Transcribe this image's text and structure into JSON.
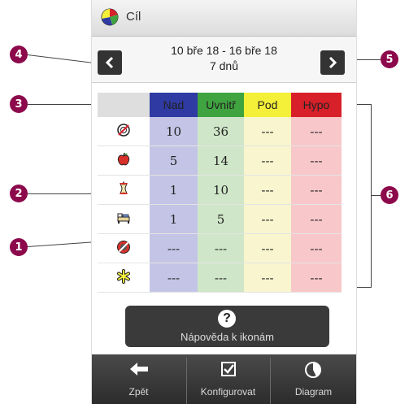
{
  "header": {
    "title": "Cíl",
    "app_icon": "pie-chart-icon"
  },
  "date_range": {
    "dates": "10 bře 18 - 16 bře 18",
    "span": "7 dnů"
  },
  "table": {
    "columns": [
      "Nad",
      "Uvnitř",
      "Pod",
      "Hypo"
    ],
    "column_colors": [
      "#2f3aa3",
      "#3fa43f",
      "#f4ef38",
      "#d8202a"
    ],
    "rows": [
      {
        "icon": "no-meal-mark-icon",
        "values": [
          "10",
          "36",
          "---",
          "---"
        ]
      },
      {
        "icon": "before-meal-apple-icon",
        "values": [
          "5",
          "14",
          "---",
          "---"
        ]
      },
      {
        "icon": "after-meal-apple-core-icon",
        "values": [
          "1",
          "10",
          "---",
          "---"
        ]
      },
      {
        "icon": "bedtime-icon",
        "values": [
          "1",
          "5",
          "---",
          "---"
        ]
      },
      {
        "icon": "fasting-icon",
        "values": [
          "---",
          "---",
          "---",
          "---"
        ]
      },
      {
        "icon": "other-asterisk-icon",
        "values": [
          "---",
          "---",
          "---",
          "---"
        ]
      }
    ]
  },
  "help_button": {
    "label": "Nápověda k ikonám"
  },
  "toolbar": {
    "back": "Zpět",
    "configure": "Konfigurovat",
    "diagram": "Diagram"
  },
  "callouts": [
    "1",
    "2",
    "3",
    "4",
    "5",
    "6"
  ]
}
